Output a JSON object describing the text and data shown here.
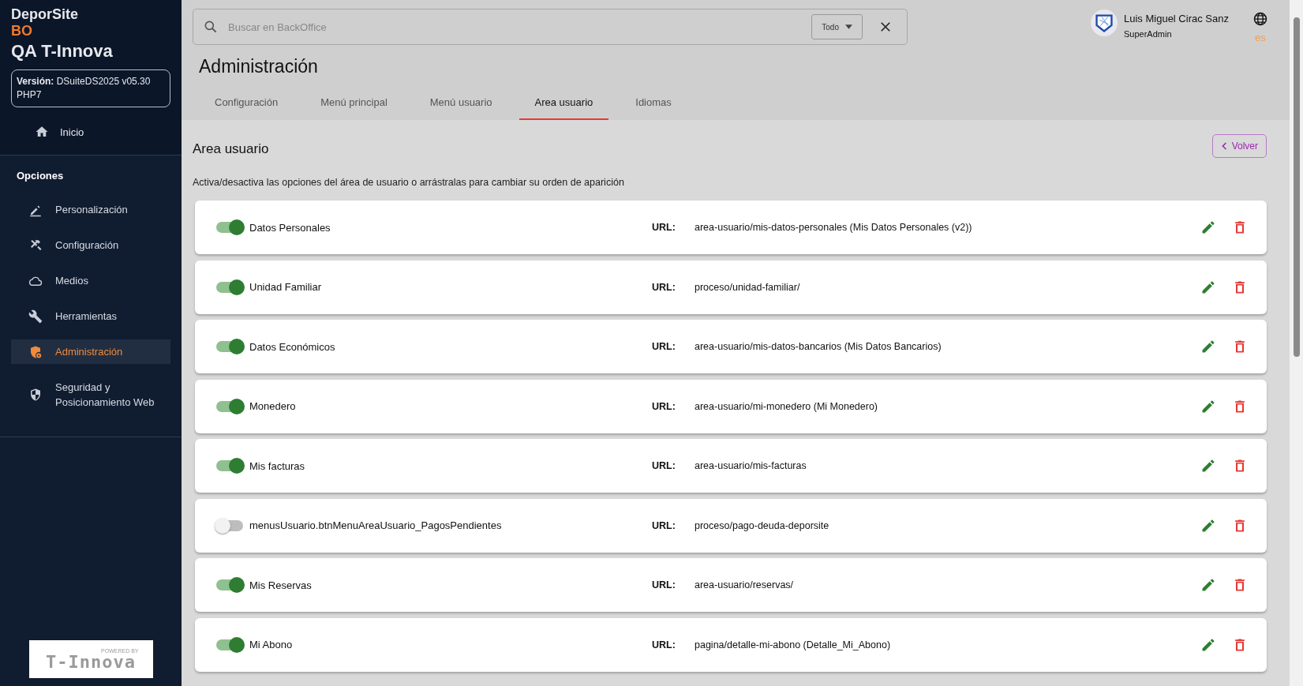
{
  "sidebar": {
    "brand": "DeporSite",
    "brand_sub": "BO",
    "site": "QA T-Innova",
    "version_label": "Versión:",
    "version": "DSuiteDS2025 v05.30 PHP7",
    "home": {
      "label": "Inicio"
    },
    "section_title": "Opciones",
    "items": [
      {
        "label": "Personalización",
        "selected": false
      },
      {
        "label": "Configuración",
        "selected": false
      },
      {
        "label": "Medios",
        "selected": false
      },
      {
        "label": "Herramientas",
        "selected": false
      },
      {
        "label": "Administración",
        "selected": true
      },
      {
        "label": "Seguridad y Posicionamiento Web",
        "selected": false
      }
    ],
    "footer_logo": {
      "small": "POWERED BY",
      "name": "T-Innova"
    }
  },
  "search": {
    "placeholder": "Buscar en BackOffice",
    "scope": "Todo"
  },
  "user": {
    "name": "Luis Miguel Cirac Sanz",
    "role": "SuperAdmin",
    "language": "es"
  },
  "page_title": "Administración",
  "tabs": [
    {
      "label": "Configuración",
      "selected": false
    },
    {
      "label": "Menú principal",
      "selected": false
    },
    {
      "label": "Menú usuario",
      "selected": false
    },
    {
      "label": "Area usuario",
      "selected": true
    },
    {
      "label": "Idiomas",
      "selected": false
    }
  ],
  "section": {
    "title": "Area usuario",
    "back_button": "Volver",
    "description": "Activa/desactiva las opciones del área de usuario o arrástralas para cambiar su orden de aparición"
  },
  "options": [
    {
      "name": "Datos Personales",
      "on": true,
      "url_label": "URL:",
      "url": "area-usuario/mis-datos-personales (Mis Datos Personales (v2))"
    },
    {
      "name": "Unidad Familiar",
      "on": true,
      "url_label": "URL:",
      "url": "proceso/unidad-familiar/"
    },
    {
      "name": "Datos Económicos",
      "on": true,
      "url_label": "URL:",
      "url": "area-usuario/mis-datos-bancarios (Mis Datos Bancarios)"
    },
    {
      "name": "Monedero",
      "on": true,
      "url_label": "URL:",
      "url": "area-usuario/mi-monedero (Mi Monedero)"
    },
    {
      "name": "Mis facturas",
      "on": true,
      "url_label": "URL:",
      "url": "area-usuario/mis-facturas"
    },
    {
      "name": "menusUsuario.btnMenuAreaUsuario_PagosPendientes",
      "on": false,
      "url_label": "URL:",
      "url": "proceso/pago-deuda-deporsite"
    },
    {
      "name": "Mis Reservas",
      "on": true,
      "url_label": "URL:",
      "url": "area-usuario/reservas/"
    },
    {
      "name": "Mi Abono",
      "on": true,
      "url_label": "URL:",
      "url": "pagina/detalle-mi-abono (Detalle_Mi_Abono)"
    }
  ]
}
